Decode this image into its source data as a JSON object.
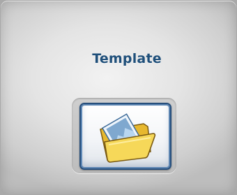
{
  "panel": {
    "title": "Template",
    "open_button": {
      "icon": "open-folder-with-document-icon"
    }
  },
  "colors": {
    "title_text": "#1f4f7a",
    "button_border": "#274f7c",
    "folder_yellow": "#f2d14a",
    "document_blue": "#7fa8cf"
  }
}
